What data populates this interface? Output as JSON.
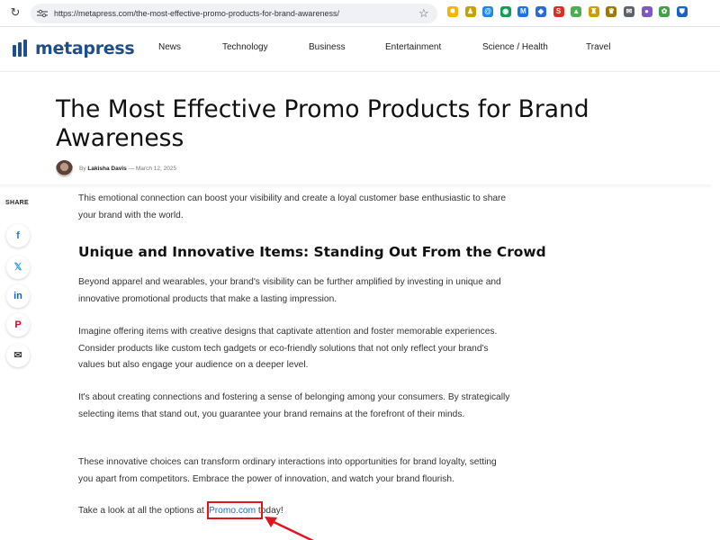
{
  "browser": {
    "reload_icon": "reload-icon",
    "url": "https://metapress.com/the-most-effective-promo-products-for-brand-awareness/",
    "bookmark_icon": "star-icon",
    "extensions": [
      {
        "name": "ext-icon-1",
        "color": "#f4b400",
        "glyph": "✸"
      },
      {
        "name": "ext-icon-2",
        "color": "#c8a000",
        "glyph": "♟"
      },
      {
        "name": "ext-icon-3",
        "color": "#1e88e5",
        "glyph": "@"
      },
      {
        "name": "ext-icon-4",
        "color": "#0f9d58",
        "glyph": "◉"
      },
      {
        "name": "ext-icon-5",
        "color": "#1a73e8",
        "glyph": "M"
      },
      {
        "name": "ext-icon-6",
        "color": "#2b6bd6",
        "glyph": "◆"
      },
      {
        "name": "ext-icon-7",
        "color": "#d93025",
        "glyph": "S"
      },
      {
        "name": "ext-icon-8",
        "color": "#4caf50",
        "glyph": "▲"
      },
      {
        "name": "ext-icon-9",
        "color": "#c8a000",
        "glyph": "♜"
      },
      {
        "name": "ext-icon-10",
        "color": "#9a7b00",
        "glyph": "♛"
      },
      {
        "name": "ext-icon-11",
        "color": "#5f6368",
        "glyph": "✉"
      },
      {
        "name": "ext-icon-12",
        "color": "#7e57c2",
        "glyph": "●"
      },
      {
        "name": "ext-icon-13",
        "color": "#43a047",
        "glyph": "✿"
      },
      {
        "name": "ext-icon-14",
        "color": "#1565c0",
        "glyph": "⛊"
      }
    ]
  },
  "site": {
    "logo_text": "metapress",
    "brand_color": "#1e4f8a",
    "nav": [
      "News",
      "Technology",
      "Business",
      "Entertainment",
      "Science / Health",
      "Travel"
    ]
  },
  "article": {
    "title": "The Most Effective Promo Products for Brand Awareness",
    "byline_prefix": "By",
    "author": "Lakisha Davis",
    "date_separator": "—",
    "date": "March 12, 2025",
    "intro": "This emotional connection can boost your visibility and create a loyal customer base enthusiastic to share your brand with the world.",
    "section_heading": "Unique and Innovative Items: Standing Out From the Crowd",
    "paragraphs": [
      "Beyond apparel and wearables, your brand's visibility can be further amplified by investing in unique and innovative promotional products that make a lasting impression.",
      "Imagine offering items with creative designs that captivate attention and foster memorable experiences. Consider products like custom tech gadgets or eco-friendly solutions that not only reflect your brand's values but also engage your audience on a deeper level.",
      "It's about creating connections and fostering a sense of belonging among your consumers. By strategically selecting items that stand out, you guarantee your brand remains at the forefront of their minds.",
      "These innovative choices can transform ordinary interactions into opportunities for brand loyalty, setting you apart from competitors. Embrace the power of innovation, and watch your brand flourish."
    ],
    "cta_before": "Take a look at all the options at ",
    "cta_link": "iPromo.com",
    "cta_after": " today!",
    "link_color": "#1a6fc9"
  },
  "share": {
    "label": "SHARE",
    "buttons": [
      {
        "name": "facebook-icon",
        "glyph": "f",
        "color": "#1877f2"
      },
      {
        "name": "x-icon",
        "glyph": "𝕏",
        "color": "#1da1f2"
      },
      {
        "name": "linkedin-icon",
        "glyph": "in",
        "color": "#0a66c2"
      },
      {
        "name": "pinterest-icon",
        "glyph": "P",
        "color": "#e60023"
      },
      {
        "name": "email-icon",
        "glyph": "✉",
        "color": "#444444"
      }
    ]
  },
  "annotation": {
    "highlight_color": "#e0141b"
  }
}
